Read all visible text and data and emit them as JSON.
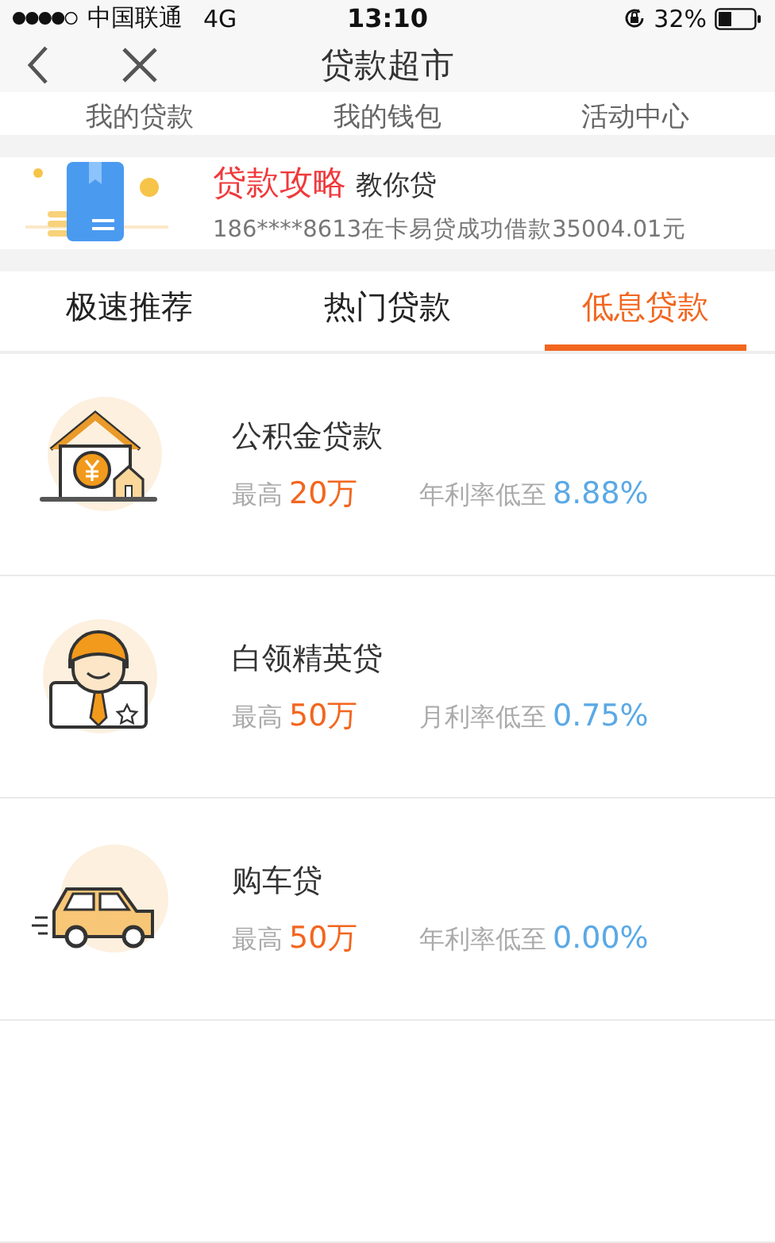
{
  "status_bar": {
    "carrier": "中国联通",
    "network": "4G",
    "time": "13:10",
    "battery": "32%"
  },
  "nav": {
    "title": "贷款超市"
  },
  "quick_links": [
    "我的贷款",
    "我的钱包",
    "活动中心"
  ],
  "banner": {
    "title": "贷款攻略",
    "subtitle": "教你贷",
    "message": "186****8613在卡易贷成功借款35004.01元"
  },
  "tabs": [
    {
      "label": "极速推荐",
      "selected": false
    },
    {
      "label": "热门贷款",
      "selected": false
    },
    {
      "label": "低息贷款",
      "selected": true
    }
  ],
  "products": [
    {
      "kind": "house",
      "name": "公积金贷款",
      "max_label": "最高",
      "max_value": "20万",
      "rate_label": "年利率低至",
      "rate_value": "8.88%"
    },
    {
      "kind": "person",
      "name": "白领精英贷",
      "max_label": "最高",
      "max_value": "50万",
      "rate_label": "月利率低至",
      "rate_value": "0.75%"
    },
    {
      "kind": "car",
      "name": "购车贷",
      "max_label": "最高",
      "max_value": "50万",
      "rate_label": "年利率低至",
      "rate_value": "0.00%"
    }
  ]
}
